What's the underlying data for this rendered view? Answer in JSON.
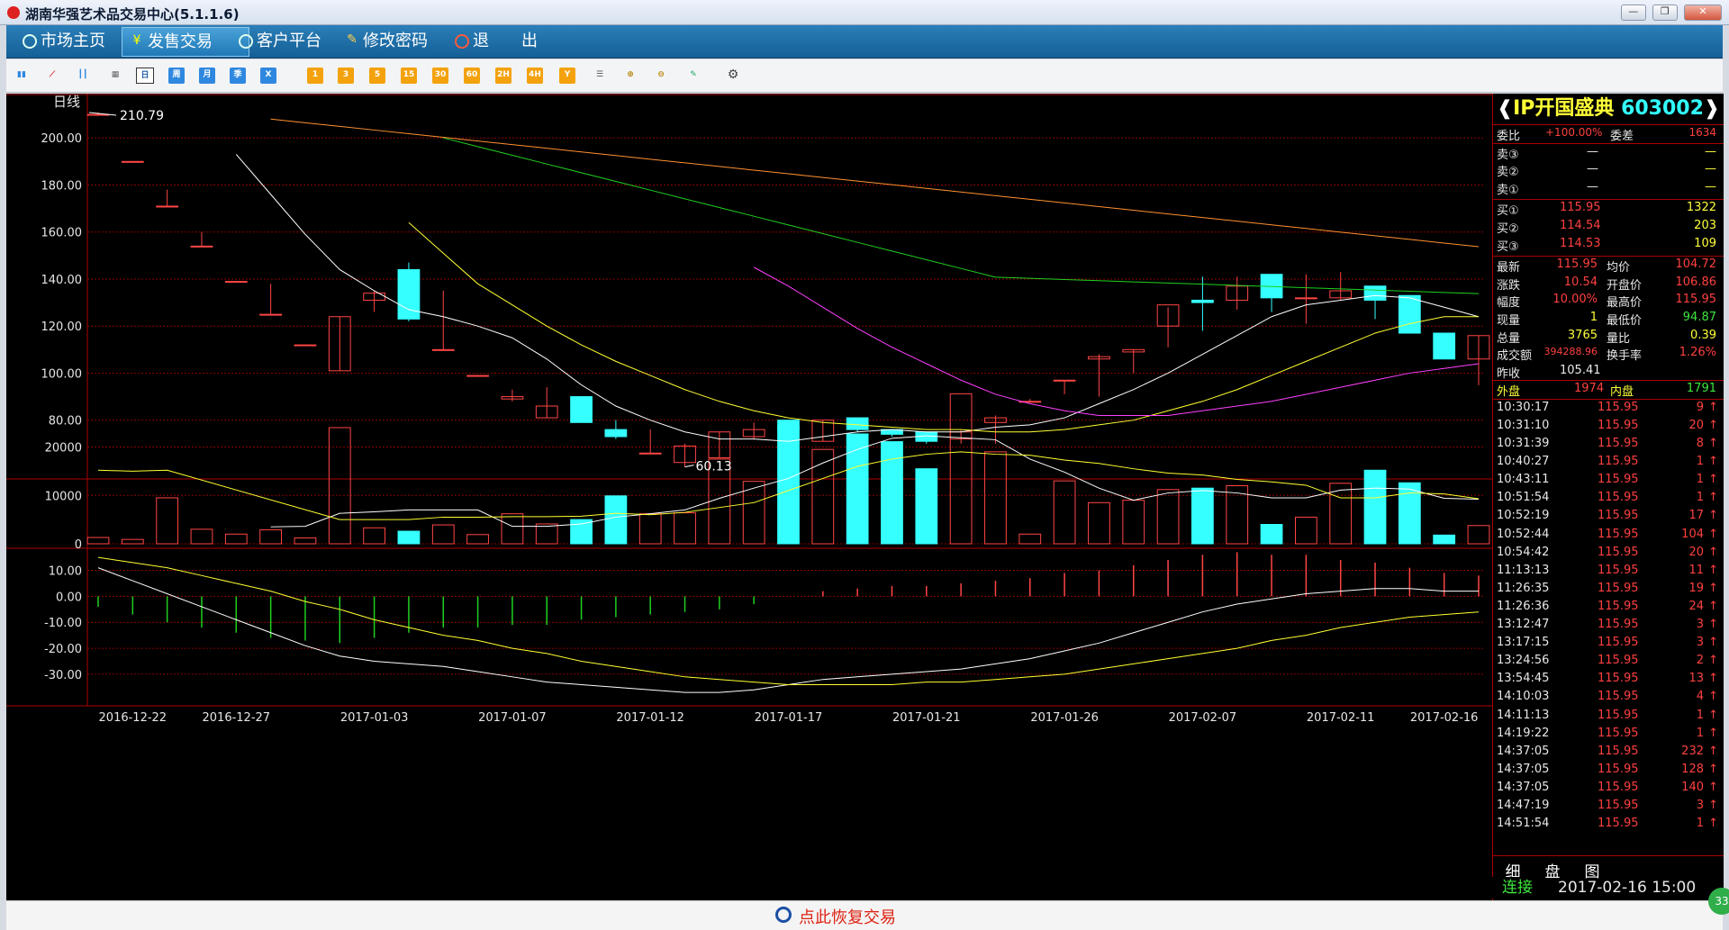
{
  "window": {
    "title": "湖南华强艺术品交易中心(5.1.1.6)",
    "min": "—",
    "max": "❐",
    "close": "✕"
  },
  "nav": [
    {
      "label": "市场主页",
      "icon": "refresh-icon"
    },
    {
      "label": "发售交易",
      "icon": "yen-icon"
    },
    {
      "label": "客户平台",
      "icon": "refresh-icon"
    },
    {
      "label": "修改密码",
      "icon": "key-icon"
    },
    {
      "label": "退　　出",
      "icon": "power-icon"
    }
  ],
  "toolbar": {
    "period_buttons": [
      "日",
      "周",
      "月",
      "季",
      "X"
    ],
    "minute_buttons": [
      "1",
      "3",
      "5",
      "15",
      "30",
      "60",
      "2H",
      "4H",
      "Y"
    ]
  },
  "chart": {
    "period_label": "日线",
    "max_label": "210.79",
    "min_label": "60.13",
    "price_ticks": [
      "200.00",
      "180.00",
      "160.00",
      "140.00",
      "120.00",
      "100.00",
      "80.00"
    ],
    "volume_ticks": [
      "20000",
      "10000",
      "0"
    ],
    "macd_ticks": [
      "10.00",
      "0.00",
      "-10.00",
      "-20.00",
      "-30.00"
    ],
    "dates": [
      "2016-12-22",
      "2016-12-27",
      "2017-01-03",
      "2017-01-07",
      "2017-01-12",
      "2017-01-17",
      "2017-01-21",
      "2017-01-26",
      "2017-02-07",
      "2017-02-11",
      "2017-02-16"
    ],
    "colors": {
      "up": "#ff4545",
      "down": "#35ffff",
      "grid": "#8b0000",
      "ma5": "#ffffff",
      "ma10": "#ffff30",
      "ma20": "#ff40ff",
      "ma30": "#20d020",
      "ma60": "#ff9030"
    }
  },
  "chart_data": {
    "type": "candlestick",
    "ylim": [
      55,
      215
    ],
    "candles": [
      {
        "o": 210,
        "h": 210.79,
        "l": 210,
        "c": 210,
        "v": 1300
      },
      {
        "o": 190,
        "h": 190,
        "l": 190,
        "c": 190,
        "v": 900
      },
      {
        "o": 171,
        "h": 178,
        "l": 171,
        "c": 171,
        "v": 9500
      },
      {
        "o": 154,
        "h": 160,
        "l": 154,
        "c": 154,
        "v": 3000
      },
      {
        "o": 139,
        "h": 139,
        "l": 139,
        "c": 139,
        "v": 2000
      },
      {
        "o": 125,
        "h": 138,
        "l": 125,
        "c": 125,
        "v": 2900
      },
      {
        "o": 112,
        "h": 112,
        "l": 112,
        "c": 112,
        "v": 1200
      },
      {
        "o": 101,
        "h": 124,
        "l": 101,
        "c": 124,
        "v": 24000
      },
      {
        "o": 131,
        "h": 135,
        "l": 126,
        "c": 134,
        "v": 3300
      },
      {
        "o": 144,
        "h": 147,
        "l": 122,
        "c": 123,
        "v": 2600
      },
      {
        "o": 110,
        "h": 135,
        "l": 110,
        "c": 110,
        "v": 3900
      },
      {
        "o": 99,
        "h": 99,
        "l": 99,
        "c": 99,
        "v": 1900
      },
      {
        "o": 89,
        "h": 93,
        "l": 88,
        "c": 90,
        "v": 6200
      },
      {
        "o": 81,
        "h": 94,
        "l": 81,
        "c": 86,
        "v": 4100
      },
      {
        "o": 90,
        "h": 90,
        "l": 79,
        "c": 79,
        "v": 5000
      },
      {
        "o": 76,
        "h": 80,
        "l": 72,
        "c": 73,
        "v": 9900
      },
      {
        "o": 66,
        "h": 76,
        "l": 66,
        "c": 66,
        "v": 6200
      },
      {
        "o": 62,
        "h": 70,
        "l": 60.13,
        "c": 69,
        "v": 6400
      },
      {
        "o": 64,
        "h": 75,
        "l": 64,
        "c": 75,
        "v": 17500
      },
      {
        "o": 73,
        "h": 79,
        "l": 72,
        "c": 76,
        "v": 12900
      },
      {
        "o": 80,
        "h": 80,
        "l": 75,
        "c": 76,
        "v": 24300
      },
      {
        "o": 71,
        "h": 80,
        "l": 71,
        "c": 80,
        "v": 19500
      },
      {
        "o": 81,
        "h": 81,
        "l": 75,
        "c": 76,
        "v": 22700
      },
      {
        "o": 76,
        "h": 76,
        "l": 73,
        "c": 74,
        "v": 21100
      },
      {
        "o": 75,
        "h": 75,
        "l": 70,
        "c": 71,
        "v": 15500
      },
      {
        "o": 72,
        "h": 76,
        "l": 70,
        "c": 75,
        "v": 31000
      },
      {
        "o": 79,
        "h": 82,
        "l": 70,
        "c": 81,
        "v": 19000
      },
      {
        "o": 88,
        "h": 89,
        "l": 88,
        "c": 88,
        "v": 2000
      },
      {
        "o": 97,
        "h": 97,
        "l": 91,
        "c": 97,
        "v": 13000
      },
      {
        "o": 106,
        "h": 108,
        "l": 90,
        "c": 107,
        "v": 8500
      },
      {
        "o": 109,
        "h": 110,
        "l": 100,
        "c": 110,
        "v": 9000
      },
      {
        "o": 120,
        "h": 128,
        "l": 111,
        "c": 129,
        "v": 11200
      },
      {
        "o": 131,
        "h": 141,
        "l": 118,
        "c": 130,
        "v": 11500
      },
      {
        "o": 131,
        "h": 141,
        "l": 127,
        "c": 137,
        "v": 12000
      },
      {
        "o": 142,
        "h": 142,
        "l": 126,
        "c": 132,
        "v": 4000
      },
      {
        "o": 132,
        "h": 142,
        "l": 121,
        "c": 132,
        "v": 5500
      },
      {
        "o": 132,
        "h": 143,
        "l": 131,
        "c": 135,
        "v": 12500
      },
      {
        "o": 137,
        "h": 137,
        "l": 123,
        "c": 131,
        "v": 15200
      },
      {
        "o": 133,
        "h": 133,
        "l": 117,
        "c": 117,
        "v": 12600
      },
      {
        "o": 117,
        "h": 117,
        "l": 106,
        "c": 106,
        "v": 1800
      },
      {
        "o": 106,
        "h": 115.95,
        "l": 94.87,
        "c": 115.95,
        "v": 3765
      }
    ],
    "ma5": [
      null,
      null,
      null,
      null,
      193,
      176,
      159,
      144,
      135,
      127,
      124,
      120,
      115,
      106,
      95,
      86,
      80,
      75,
      72,
      72,
      71,
      73,
      75,
      76,
      75,
      75,
      77,
      78,
      81,
      87,
      93,
      100,
      108,
      116,
      124,
      129,
      131,
      133,
      132,
      128,
      124
    ],
    "ma10": [
      null,
      null,
      null,
      null,
      null,
      null,
      null,
      null,
      null,
      164,
      151,
      138,
      129,
      120,
      112,
      105,
      99,
      93,
      88,
      84,
      81,
      79,
      78,
      77,
      76,
      76,
      75,
      75,
      76,
      78,
      80,
      84,
      88,
      93,
      99,
      105,
      111,
      117,
      121,
      124,
      124
    ],
    "ma20": [
      null,
      null,
      null,
      null,
      null,
      null,
      null,
      null,
      null,
      null,
      null,
      null,
      null,
      null,
      null,
      null,
      null,
      null,
      null,
      145,
      137,
      128,
      119,
      111,
      104,
      97,
      91,
      87,
      84,
      82,
      82,
      82,
      84,
      86,
      88,
      91,
      94,
      97,
      100,
      102,
      104
    ],
    "ma30": [
      null,
      null,
      null,
      null,
      null,
      null,
      null,
      null,
      null,
      null,
      null,
      null,
      null,
      null,
      null,
      null,
      null,
      null,
      null,
      null,
      null,
      null,
      null,
      null,
      null,
      null,
      null,
      null,
      null,
      null,
      null,
      null,
      null,
      null,
      null,
      null,
      null,
      null,
      null,
      null,
      null
    ],
    "macd_dif": [
      11,
      6,
      1,
      -4,
      -9,
      -14,
      -19,
      -23,
      -25,
      -26,
      -27,
      -29,
      -31,
      -33,
      -34,
      -35,
      -36,
      -37,
      -37,
      -36,
      -34,
      -32,
      -31,
      -30,
      -29,
      -28,
      -26,
      -24,
      -21,
      -18,
      -14,
      -10,
      -6,
      -3,
      -1,
      1,
      2,
      3,
      3,
      2,
      2
    ],
    "macd_dea": [
      15,
      13,
      11,
      8,
      5,
      2,
      -2,
      -5,
      -9,
      -12,
      -15,
      -17,
      -20,
      -22,
      -25,
      -27,
      -29,
      -31,
      -32,
      -33,
      -34,
      -34,
      -34,
      -34,
      -33,
      -33,
      -32,
      -31,
      -30,
      -28,
      -26,
      -24,
      -22,
      -20,
      -17,
      -15,
      -12,
      -10,
      -8,
      -7,
      -6
    ],
    "macd_hist": [
      -4,
      -7,
      -10,
      -12,
      -14,
      -16,
      -17,
      -18,
      -16,
      -14,
      -12,
      -12,
      -11,
      -11,
      -9,
      -8,
      -7,
      -6,
      -5,
      -3,
      0,
      2,
      3,
      4,
      4,
      5,
      6,
      7,
      9,
      10,
      12,
      14,
      16,
      17,
      16,
      16,
      14,
      13,
      11,
      9,
      8
    ],
    "vol_ma5": [
      null,
      null,
      null,
      null,
      null,
      3500,
      3600,
      6300,
      6600,
      7000,
      7000,
      7000,
      3600,
      3600,
      4100,
      5500,
      6200,
      7000,
      9400,
      11500,
      13500,
      16700,
      19500,
      21800,
      22300,
      21900,
      21500,
      17500,
      14800,
      11500,
      9000,
      10500,
      11000,
      10500,
      9500,
      9500,
      11100,
      11500,
      11300,
      9400,
      9200
    ],
    "vol_ma10": [
      15200,
      15000,
      15200,
      null,
      null,
      null,
      null,
      5000,
      5000,
      5000,
      5500,
      5500,
      5600,
      5600,
      5700,
      6300,
      6000,
      6500,
      7500,
      8500,
      11000,
      13500,
      16000,
      17500,
      18500,
      19000,
      18500,
      18300,
      17300,
      16600,
      15500,
      14600,
      14200,
      13300,
      12800,
      12100,
      9500,
      9500,
      10500,
      10300,
      9300
    ]
  },
  "quote": {
    "name": "IP开国盛典",
    "code": "603002",
    "weibi_label": "委比",
    "weibi": "+100.00%",
    "weicha_label": "委差",
    "weicha": "1634",
    "sell": [
      {
        "label": "卖③",
        "price": "—",
        "vol": "—"
      },
      {
        "label": "卖②",
        "price": "—",
        "vol": "—"
      },
      {
        "label": "卖①",
        "price": "—",
        "vol": "—"
      }
    ],
    "buy": [
      {
        "label": "买①",
        "price": "115.95",
        "vol": "1322"
      },
      {
        "label": "买②",
        "price": "114.54",
        "vol": "203"
      },
      {
        "label": "买③",
        "price": "114.53",
        "vol": "109"
      }
    ],
    "stats": [
      {
        "l1": "最新",
        "v1": "115.95",
        "l2": "均价",
        "v2": "104.72"
      },
      {
        "l1": "涨跌",
        "v1": "10.54",
        "l2": "开盘价",
        "v2": "106.86"
      },
      {
        "l1": "幅度",
        "v1": "10.00%",
        "l2": "最高价",
        "v2": "115.95"
      },
      {
        "l1": "现量",
        "v1": "1",
        "l2": "最低价",
        "v2": "94.87"
      },
      {
        "l1": "总量",
        "v1": "3765",
        "l2": "量比",
        "v2": "0.39"
      },
      {
        "l1": "成交额",
        "v1": "394288.96",
        "l2": "换手率",
        "v2": "1.26%"
      }
    ],
    "prev_close_label": "昨收",
    "prev_close": "105.41",
    "outer_label": "外盘",
    "outer": "1974",
    "inner_label": "内盘",
    "inner": "1791",
    "ticks": [
      {
        "t": "10:30:17",
        "p": "115.95",
        "v": "9"
      },
      {
        "t": "10:31:10",
        "p": "115.95",
        "v": "20"
      },
      {
        "t": "10:31:39",
        "p": "115.95",
        "v": "8"
      },
      {
        "t": "10:40:27",
        "p": "115.95",
        "v": "1"
      },
      {
        "t": "10:43:11",
        "p": "115.95",
        "v": "1"
      },
      {
        "t": "10:51:54",
        "p": "115.95",
        "v": "1"
      },
      {
        "t": "10:52:19",
        "p": "115.95",
        "v": "17"
      },
      {
        "t": "10:52:44",
        "p": "115.95",
        "v": "104"
      },
      {
        "t": "10:54:42",
        "p": "115.95",
        "v": "20"
      },
      {
        "t": "11:13:13",
        "p": "115.95",
        "v": "11"
      },
      {
        "t": "11:26:35",
        "p": "115.95",
        "v": "19"
      },
      {
        "t": "11:26:36",
        "p": "115.95",
        "v": "24"
      },
      {
        "t": "13:12:47",
        "p": "115.95",
        "v": "3"
      },
      {
        "t": "13:17:15",
        "p": "115.95",
        "v": "3"
      },
      {
        "t": "13:24:56",
        "p": "115.95",
        "v": "2"
      },
      {
        "t": "13:54:45",
        "p": "115.95",
        "v": "13"
      },
      {
        "t": "14:10:03",
        "p": "115.95",
        "v": "4"
      },
      {
        "t": "14:11:13",
        "p": "115.95",
        "v": "1"
      },
      {
        "t": "14:19:22",
        "p": "115.95",
        "v": "1"
      },
      {
        "t": "14:37:05",
        "p": "115.95",
        "v": "232"
      },
      {
        "t": "14:37:05",
        "p": "115.95",
        "v": "128"
      },
      {
        "t": "14:37:05",
        "p": "115.95",
        "v": "140"
      },
      {
        "t": "14:47:19",
        "p": "115.95",
        "v": "3"
      },
      {
        "t": "14:51:54",
        "p": "115.95",
        "v": "1"
      }
    ],
    "tabs": [
      "细",
      "盘",
      "图"
    ]
  },
  "status": {
    "restore": "点此恢复交易",
    "connection": "连接",
    "datetime": "2017-02-16 15:00",
    "badge": "33"
  }
}
